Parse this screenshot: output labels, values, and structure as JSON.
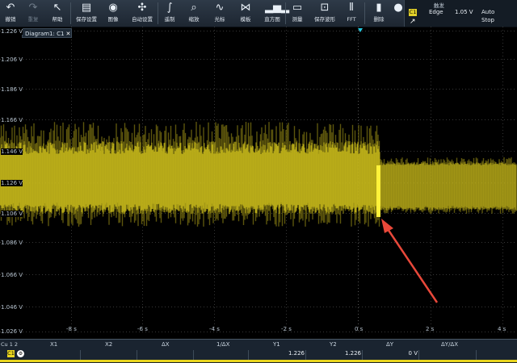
{
  "toolbar": {
    "items": [
      {
        "label": "撤销",
        "icon": "undo-icon",
        "glyph": "↶"
      },
      {
        "label": "重复",
        "icon": "redo-icon",
        "glyph": "↷",
        "disabled": true
      },
      {
        "label": "帮助",
        "icon": "help-pointer-icon",
        "glyph": "↖"
      },
      {
        "label": "保存设置",
        "icon": "save-icon",
        "glyph": "▤"
      },
      {
        "label": "图像",
        "icon": "camera-icon",
        "glyph": "◉"
      },
      {
        "label": "自动设置",
        "icon": "autoset-icon",
        "glyph": "✣"
      },
      {
        "label": "遥制",
        "icon": "remote-icon",
        "glyph": "∫"
      },
      {
        "label": "缩放",
        "icon": "zoom-icon",
        "glyph": "⌕"
      },
      {
        "label": "光标",
        "icon": "cursor-icon",
        "glyph": "∿"
      },
      {
        "label": "模板",
        "icon": "mask-template-icon",
        "glyph": "⋈"
      },
      {
        "label": "直方图",
        "icon": "histogram-icon",
        "glyph": "▂▅▂"
      },
      {
        "label": "测量",
        "icon": "measure-icon",
        "glyph": "▭"
      },
      {
        "label": "保存波形",
        "icon": "save-waveform-icon",
        "glyph": "⊡"
      },
      {
        "label": "FFT",
        "icon": "fft-icon",
        "glyph": "⫴"
      },
      {
        "label": "删除",
        "icon": "trash-icon",
        "glyph": "▮"
      },
      {
        "label": "",
        "icon": "settings-dot-icon",
        "glyph": "●"
      }
    ]
  },
  "trigger": {
    "header": "触发",
    "channel": "C1",
    "type": "Edge",
    "level": "1.05 V",
    "mode_line1": "Auto",
    "mode_line2": "Stop"
  },
  "diagram": {
    "tab_label": "Diagram1: C1"
  },
  "axes": {
    "y_labels": [
      "1.226 V",
      "1.206 V",
      "1.186 V",
      "1.166 V",
      "1.146 V",
      "1.126 V",
      "1.106 V",
      "1.086 V",
      "1.066 V",
      "1.046 V",
      "1.026 V"
    ],
    "x_labels": [
      "-8 s",
      "-6 s",
      "-4 s",
      "-2 s",
      "0 s",
      "2 s",
      "4 s"
    ]
  },
  "colors": {
    "trace": "#d9c91c",
    "arrow": "#e8483a",
    "grid": "#5a5a5a",
    "trigger_marker": "#26c9e0"
  },
  "cursor_table": {
    "headers": [
      "X1",
      "X2",
      "ΔX",
      "1/ΔX",
      "Y1",
      "Y2",
      "ΔY",
      "ΔY/ΔX"
    ],
    "values": [
      "",
      "",
      "",
      "",
      "1.226",
      "1.226",
      "0 V",
      ""
    ],
    "row_header_top": "Cu 1 2",
    "row_channel": "C1"
  }
}
